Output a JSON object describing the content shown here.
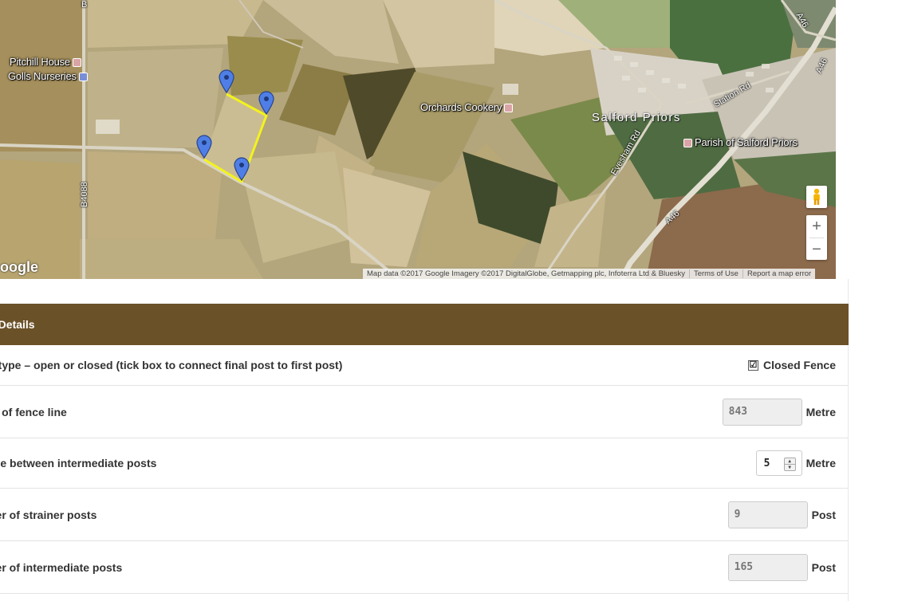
{
  "map": {
    "labels": {
      "pitchill": "Pitchill House",
      "golls": "Golls Nurseries",
      "orchards": "Orchards Cookery",
      "salford": "Salford Priors",
      "parish": "Parish of Salford Priors"
    },
    "roads": {
      "b4088_top": "B",
      "b4088": "B4088",
      "a46_top": "A46",
      "a46_right": "A46",
      "a46_mid": "A46",
      "station_rd": "Station Rd",
      "evesham_rd": "Evesham Rd"
    },
    "google_logo": "oogle",
    "attribution": {
      "data": "Map data ©2017 Google Imagery ©2017 DigitalGlobe, Getmapping plc, Infoterra Ltd & Bluesky",
      "terms": "Terms of Use",
      "report": "Report a map error"
    },
    "controls": {
      "zoom_in": "+",
      "zoom_out": "−"
    },
    "fence_color": "#f3f31c",
    "marker_color": "#4f7fe6"
  },
  "details": {
    "header": "e Details",
    "rows": [
      {
        "label": "e type – open or closed (tick box to connect final post to first post)",
        "checkbox_label": "Closed Fence",
        "checked": "☑"
      },
      {
        "label": "th of fence line",
        "value": "843",
        "unit": "Metre"
      },
      {
        "label": "nce between intermediate posts",
        "value": "5",
        "unit": "Metre"
      },
      {
        "label": "ber of strainer posts",
        "value": "9",
        "unit": "Post"
      },
      {
        "label": "ber of intermediate posts",
        "value": "165",
        "unit": "Post"
      }
    ]
  },
  "colors": {
    "header_bg": "#6b5128",
    "header_text": "#ffffff"
  }
}
